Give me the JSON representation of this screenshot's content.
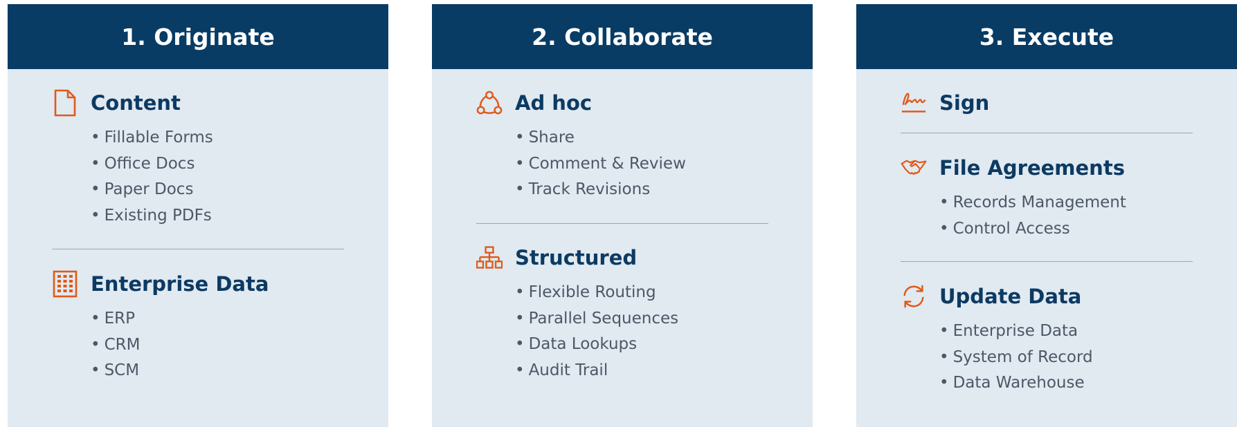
{
  "columns": [
    {
      "header": "1. Originate",
      "sections": [
        {
          "icon": "document-icon",
          "title": "Content",
          "items": [
            "Fillable Forms",
            "Office Docs",
            "Paper Docs",
            "Existing PDFs"
          ]
        },
        {
          "icon": "building-icon",
          "title": "Enterprise Data",
          "items": [
            "ERP",
            "CRM",
            "SCM"
          ]
        }
      ]
    },
    {
      "header": "2. Collaborate",
      "sections": [
        {
          "icon": "network-triangle-icon",
          "title": "Ad hoc",
          "items": [
            "Share",
            "Comment & Review",
            "Track Revisions"
          ]
        },
        {
          "icon": "hierarchy-icon",
          "title": "Structured",
          "items": [
            "Flexible Routing",
            "Parallel Sequences",
            "Data Lookups",
            "Audit Trail"
          ]
        }
      ]
    },
    {
      "header": "3. Execute",
      "sections": [
        {
          "icon": "signature-icon",
          "title": "Sign",
          "items": []
        },
        {
          "icon": "handshake-icon",
          "title": "File Agreements",
          "items": [
            "Records Management",
            "Control Access"
          ]
        },
        {
          "icon": "sync-icon",
          "title": "Update Data",
          "items": [
            "Enterprise Data",
            "System of Record",
            "Data Warehouse"
          ]
        }
      ]
    }
  ],
  "colors": {
    "header_bg": "#083c65",
    "panel_bg": "#e1e9f1",
    "title": "#0c3a62",
    "icon": "#e05a17",
    "text": "#4c5866",
    "divider": "#9aa8b5"
  }
}
